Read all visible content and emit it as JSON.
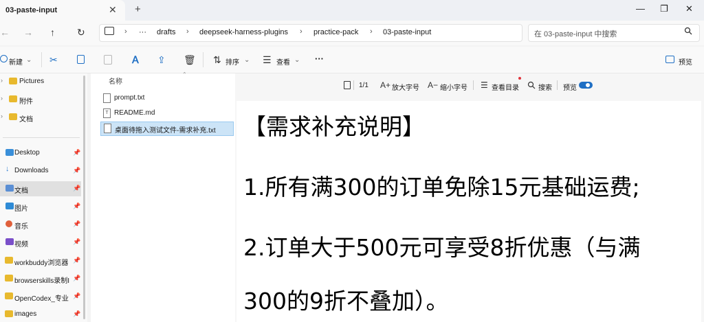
{
  "window": {
    "tab_title": "03-paste-input",
    "tab_close": "✕",
    "new_tab": "+",
    "minimize": "—",
    "maximize": "❐",
    "close": "✕"
  },
  "nav": {
    "back": "←",
    "forward": "→",
    "up": "↑",
    "refresh": "↻",
    "more": "···",
    "breadcrumbs": [
      "drafts",
      "deepseek-harness-plugins",
      "practice-pack",
      "03-paste-input"
    ],
    "separator": "›",
    "search_placeholder": "在 03-paste-input 中搜索"
  },
  "toolbar": {
    "new_label": "新建",
    "sort_label": "排序",
    "view_label": "查看",
    "more_label": "···",
    "preview_label": "预览"
  },
  "sidebar": {
    "top_items": [
      {
        "label": "Pictures",
        "icon": "folder-icon"
      },
      {
        "label": "附件",
        "icon": "folder-icon"
      },
      {
        "label": "文档",
        "icon": "folder-icon"
      }
    ],
    "pinned_items": [
      {
        "label": "Desktop",
        "icon": "desktop-icon",
        "selected": false
      },
      {
        "label": "Downloads",
        "icon": "download-icon",
        "selected": false
      },
      {
        "label": "文档",
        "icon": "documents-icon",
        "selected": true
      },
      {
        "label": "图片",
        "icon": "pictures-icon",
        "selected": false
      },
      {
        "label": "音乐",
        "icon": "music-icon",
        "selected": false
      },
      {
        "label": "视频",
        "icon": "video-icon",
        "selected": false
      },
      {
        "label": "workbuddy浏览器",
        "icon": "folder-icon",
        "selected": false
      },
      {
        "label": "browserskills录制I",
        "icon": "folder-icon",
        "selected": false
      },
      {
        "label": "OpenCodex_专业",
        "icon": "folder-icon",
        "selected": false
      },
      {
        "label": "images",
        "icon": "folder-icon",
        "selected": false
      }
    ]
  },
  "filelist": {
    "column_name": "名称",
    "files": [
      {
        "name": "prompt.txt",
        "icon": "text-file-icon",
        "selected": false
      },
      {
        "name": "README.md",
        "icon": "markdown-file-icon",
        "selected": false
      },
      {
        "name": "桌面待拖入测试文件-需求补充.txt",
        "icon": "text-file-icon",
        "selected": true
      }
    ]
  },
  "preview": {
    "page_counter": "1/1",
    "zoom_in_label": "放大字号",
    "zoom_out_label": "缩小字号",
    "toc_label": "查看目录",
    "search_label": "搜索",
    "preview_toggle_label": "预览",
    "content_lines": [
      "【需求补充说明】",
      "1.所有满300的订单免除15元基础运费;",
      "2.订单大于500元可享受8折优惠（与满",
      "300的9折不叠加）。"
    ]
  },
  "colors": {
    "accent": "#1f6fc4",
    "folder": "#e8b92e",
    "selection": "#cce4f7"
  }
}
